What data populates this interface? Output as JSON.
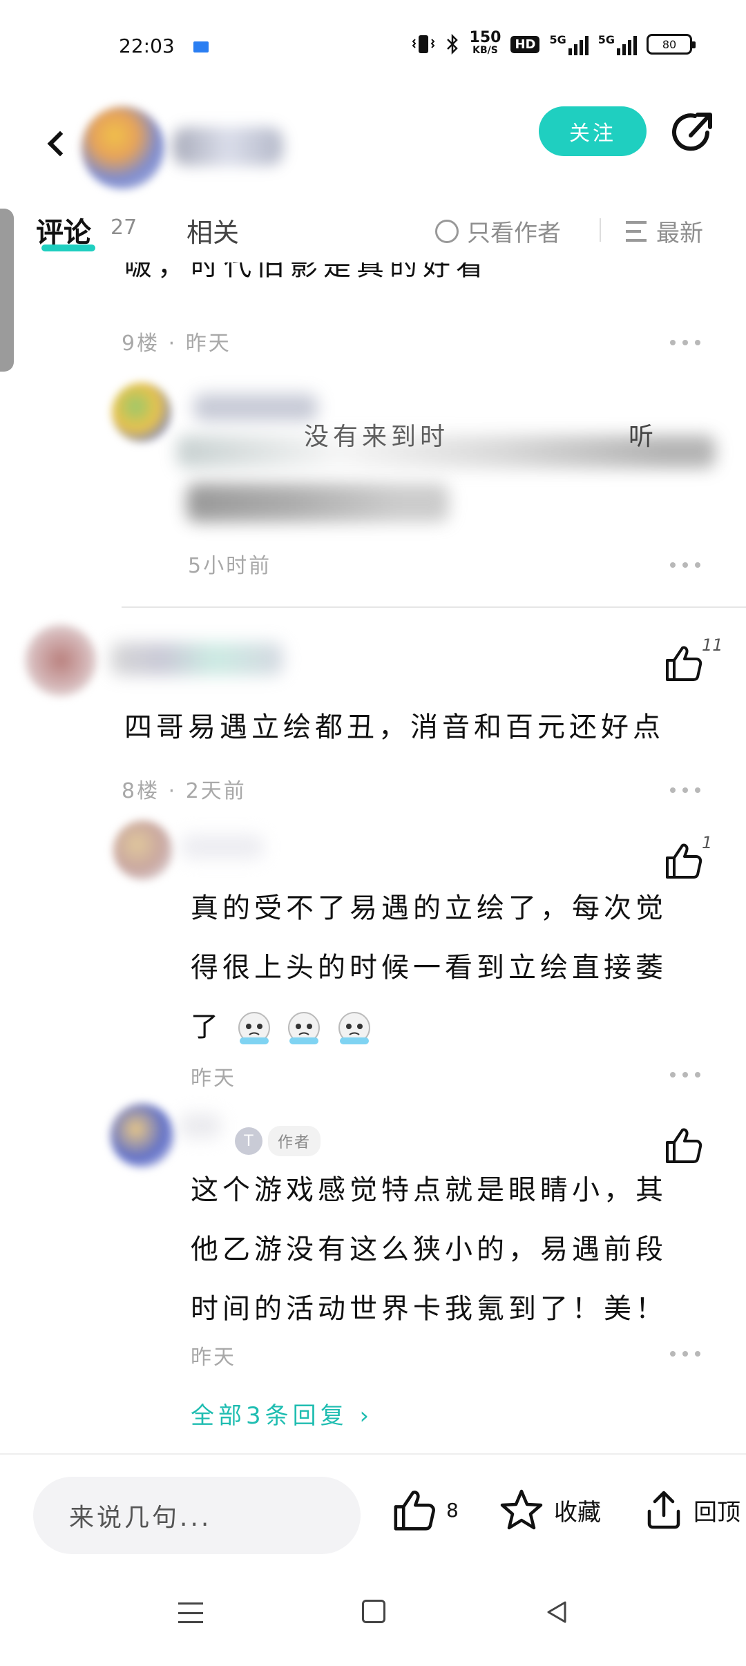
{
  "status_bar": {
    "time": "22:03",
    "net_speed": "150",
    "net_unit": "KB/S",
    "hd": "HD",
    "sig1": "5G",
    "sig2": "5G",
    "battery": "80"
  },
  "header": {
    "follow_label": "关注"
  },
  "tabs": {
    "comments_label": "评论",
    "comments_count": "27",
    "related_label": "相关",
    "author_only_label": "只看作者",
    "sort_label": "最新"
  },
  "feed": {
    "cut_text": "啵，时代旧影是真的好看",
    "floor9": {
      "meta": "9楼 · 昨天"
    },
    "reply_hidden": {
      "text_visible": "没有来到时",
      "text_tail": "听",
      "meta": "5小时前"
    },
    "floor8": {
      "like_count": "11",
      "text": "四哥易遇立绘都丑，消音和百元还好点",
      "meta": "8楼 · 2天前"
    },
    "reply1": {
      "like_count": "1",
      "line1": "真的受不了易遇的立绘了，每次觉",
      "line2": "得很上头的时候一看到立绘直接萎",
      "line3": "了",
      "meta": "昨天"
    },
    "reply2": {
      "author_badge": "T",
      "author_label": "作者",
      "line1": "这个游戏感觉特点就是眼睛小，其",
      "line2": "他乙游没有这么狭小的，易遇前段",
      "line3": "时间的活动世界卡我氪到了！美！",
      "meta": "昨天"
    },
    "all_replies": "全部3条回复 ›"
  },
  "bottom_bar": {
    "input_placeholder": "来说几句...",
    "like_count": "8",
    "collect_label": "收藏",
    "top_label": "回顶"
  },
  "colors": {
    "accent": "#1fcfc0",
    "link": "#1fbdb1",
    "meta_gray": "#a8a8a8"
  }
}
